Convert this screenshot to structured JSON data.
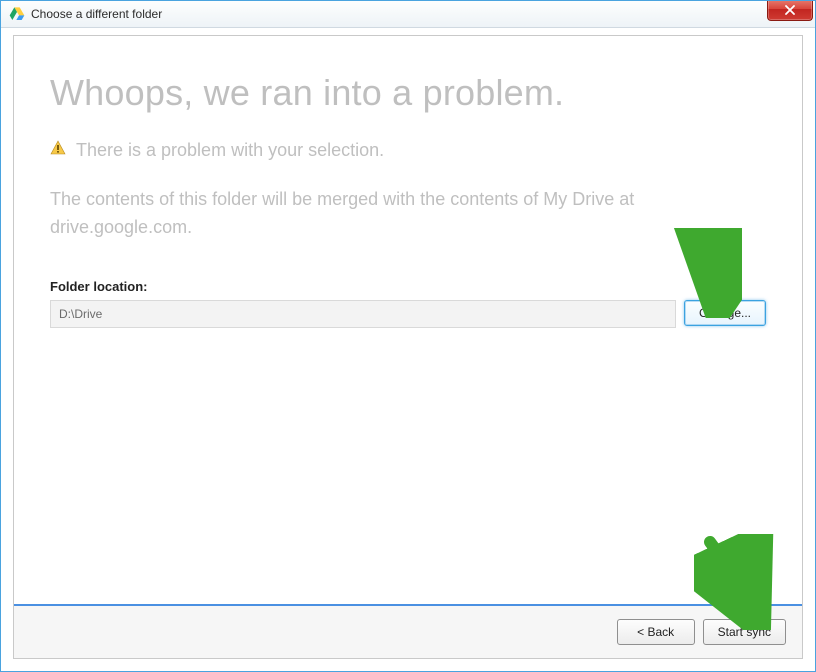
{
  "window": {
    "title": "Choose a different folder"
  },
  "heading": "Whoops, we ran into a problem.",
  "warning_text": "There is a problem with your selection.",
  "description": "The contents of this folder will be merged with the contents of My Drive at drive.google.com.",
  "folder_section": {
    "label": "Folder location:",
    "path": "D:\\Drive",
    "change_button": "Change..."
  },
  "footer": {
    "back_button": "< Back",
    "start_button": "Start sync"
  }
}
